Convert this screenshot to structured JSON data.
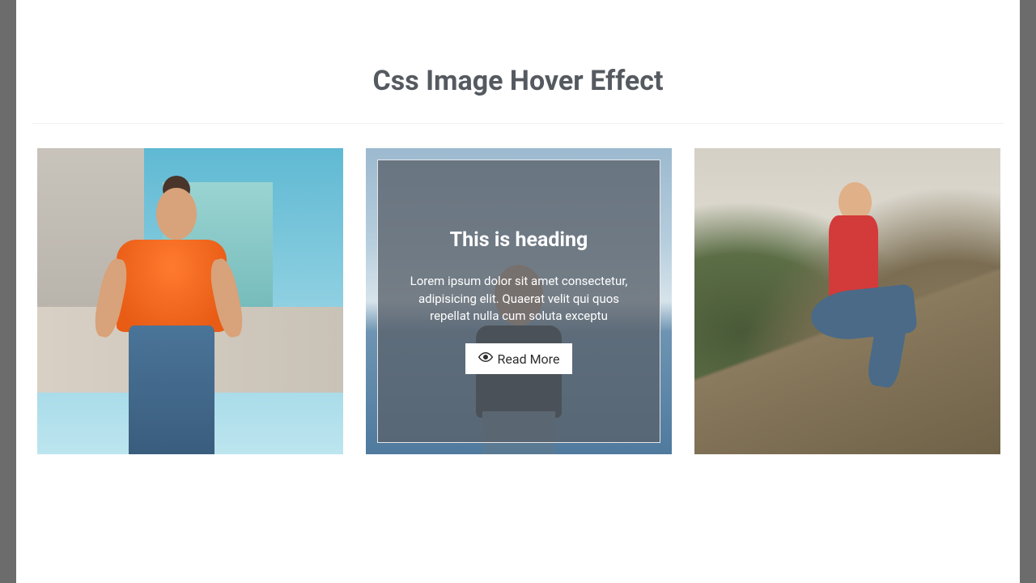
{
  "title": "Css Image Hover Effect",
  "overlay": {
    "heading": "This is heading",
    "body": "Lorem ipsum dolor sit amet consectetur, adipisicing elit. Quaerat velit qui quos repellat nulla cum soluta exceptu",
    "button_label": "Read More",
    "button_icon": "eye-icon"
  }
}
